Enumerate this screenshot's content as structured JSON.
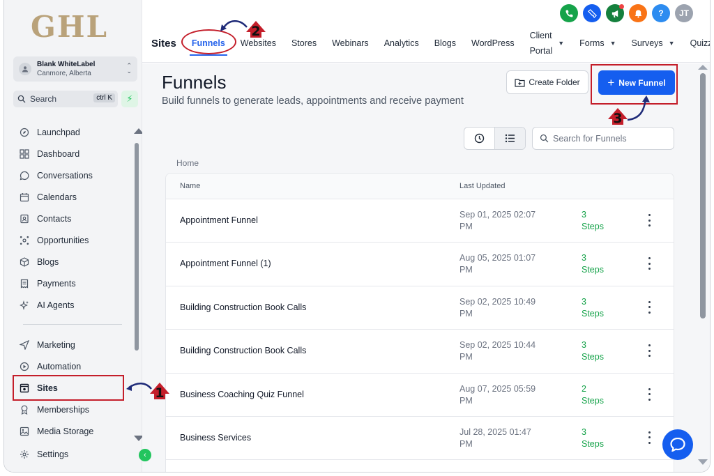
{
  "brand": {
    "logo_text": "GHL",
    "logo_color": "#b9a27a"
  },
  "account": {
    "name": "Blank WhiteLabel",
    "location": "Canmore, Alberta"
  },
  "sidebar_search": {
    "placeholder": "Search",
    "shortcut": "ctrl K"
  },
  "sidebar": {
    "items": [
      {
        "label": "Launchpad",
        "icon": "launchpad-icon"
      },
      {
        "label": "Dashboard",
        "icon": "dashboard-icon"
      },
      {
        "label": "Conversations",
        "icon": "chat-bubble-icon"
      },
      {
        "label": "Calendars",
        "icon": "calendar-icon"
      },
      {
        "label": "Contacts",
        "icon": "contacts-icon"
      },
      {
        "label": "Opportunities",
        "icon": "opportunities-icon"
      },
      {
        "label": "Blogs",
        "icon": "box-icon"
      },
      {
        "label": "Payments",
        "icon": "receipt-icon"
      },
      {
        "label": "AI Agents",
        "icon": "sparkle-icon"
      }
    ],
    "items2": [
      {
        "label": "Marketing",
        "icon": "send-icon"
      },
      {
        "label": "Automation",
        "icon": "automation-icon"
      },
      {
        "label": "Sites",
        "icon": "sites-icon"
      },
      {
        "label": "Memberships",
        "icon": "badge-icon"
      },
      {
        "label": "Media Storage",
        "icon": "image-icon"
      },
      {
        "label": "Settings",
        "icon": "gear-icon"
      }
    ]
  },
  "topbar": {
    "section_title": "Sites",
    "tabs": [
      {
        "label": "Funnels",
        "active": true
      },
      {
        "label": "Websites"
      },
      {
        "label": "Stores"
      },
      {
        "label": "Webinars"
      },
      {
        "label": "Analytics"
      },
      {
        "label": "Blogs"
      },
      {
        "label": "WordPress"
      },
      {
        "label_line1": "Client",
        "label_line2": "Portal",
        "dropdown": true
      },
      {
        "label": "Forms",
        "dropdown": true
      },
      {
        "label": "Surveys",
        "dropdown": true
      },
      {
        "label": "Quizzes"
      }
    ],
    "user_initials": "JT",
    "help_glyph": "?",
    "icon_colors": {
      "phone": "#16a34a",
      "ticket": "#155eef",
      "megaphone": "#15803d",
      "bell": "#f97316",
      "help": "#2d8cf0",
      "avatar": "#9ca3af"
    }
  },
  "page": {
    "title": "Funnels",
    "subtitle": "Build funnels to generate leads, appointments and receive payment",
    "create_folder_label": "Create Folder",
    "new_funnel_label": "New Funnel",
    "search_placeholder": "Search for Funnels",
    "breadcrumb": "Home"
  },
  "table": {
    "columns": [
      "Name",
      "Last Updated"
    ],
    "rows": [
      {
        "name": "Appointment Funnel",
        "date_line1": "Sep 01, 2025 02:07",
        "date_line2": "PM",
        "steps_line1": "3",
        "steps_line2": "Steps"
      },
      {
        "name": "Appointment Funnel (1)",
        "date_line1": "Aug 05, 2025 01:07",
        "date_line2": "PM",
        "steps_line1": "3",
        "steps_line2": "Steps"
      },
      {
        "name": "Building Construction Book Calls",
        "date_line1": "Sep 02, 2025 10:49",
        "date_line2": "PM",
        "steps_line1": "3",
        "steps_line2": "Steps"
      },
      {
        "name": "Building Construction Book Calls",
        "date_line1": "Sep 02, 2025 10:44",
        "date_line2": "PM",
        "steps_line1": "3",
        "steps_line2": "Steps"
      },
      {
        "name": "Business Coaching Quiz Funnel",
        "date_line1": "Aug 07, 2025 05:59",
        "date_line2": "PM",
        "steps_line1": "2",
        "steps_line2": "Steps"
      },
      {
        "name": "Business Services",
        "date_line1": "Jul 28, 2025 01:47",
        "date_line2": "PM",
        "steps_line1": "3",
        "steps_line2": "Steps"
      }
    ]
  },
  "annotations": {
    "step1": "1",
    "step2": "2",
    "step3": "3",
    "color": "#c41e2a"
  }
}
